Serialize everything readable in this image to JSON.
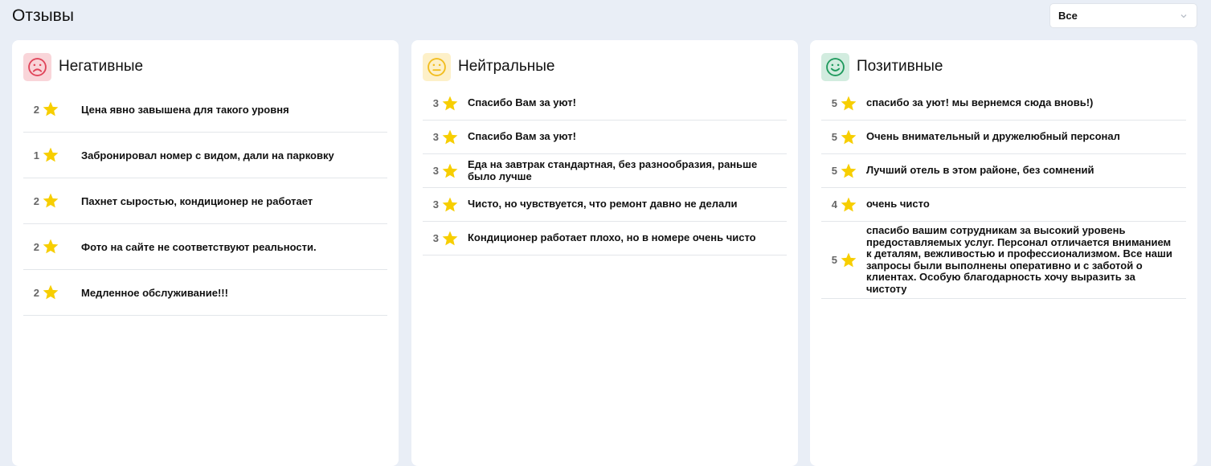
{
  "header": {
    "title": "Отзывы",
    "filter_value": "Все"
  },
  "colors": {
    "star": "#f7ce00",
    "negative": "#e0455a",
    "neutral": "#f2bd1d",
    "positive": "#1f9a5d"
  },
  "panels": [
    {
      "title": "Негативные",
      "icon": "sad-face-icon",
      "reviews": [
        {
          "rating": "2",
          "text": "Цена явно завышена для такого уровня"
        },
        {
          "rating": "1",
          "text": "Забронировал номер с видом, дали на парковку"
        },
        {
          "rating": "2",
          "text": "Пахнет сыростью, кондиционер не работает"
        },
        {
          "rating": "2",
          "text": "Фото на сайте не соответствуют реальности."
        },
        {
          "rating": "2",
          "text": "Медленное обслуживание!!!"
        }
      ]
    },
    {
      "title": "Нейтральные",
      "icon": "neutral-face-icon",
      "reviews": [
        {
          "rating": "3",
          "text": "Спасибо Вам за уют!"
        },
        {
          "rating": "3",
          "text": "Спасибо Вам за уют!"
        },
        {
          "rating": "3",
          "text": "Еда на завтрак стандартная, без разнообразия, раньше было лучше"
        },
        {
          "rating": "3",
          "text": "Чисто, но чувствуется, что ремонт давно не делали"
        },
        {
          "rating": "3",
          "text": "Кондиционер работает плохо, но в номере очень чисто"
        }
      ]
    },
    {
      "title": "Позитивные",
      "icon": "happy-face-icon",
      "reviews": [
        {
          "rating": "5",
          "text": "спасибо за уют! мы вернемся сюда вновь!)"
        },
        {
          "rating": "5",
          "text": "Очень внимательный и дружелюбный персонал"
        },
        {
          "rating": "5",
          "text": "Лучший отель в этом районе, без сомнений"
        },
        {
          "rating": "4",
          "text": "очень чисто"
        },
        {
          "rating": "5",
          "text": "спасибо вашим сотрудникам за высокий уровень предоставляемых услуг. Персонал отличается вниманием к деталям, вежливостью и профессионализмом. Все наши запросы были выполнены оперативно и с заботой о клиентах. Особую благодарность хочу выразить за чистоту"
        }
      ]
    }
  ]
}
